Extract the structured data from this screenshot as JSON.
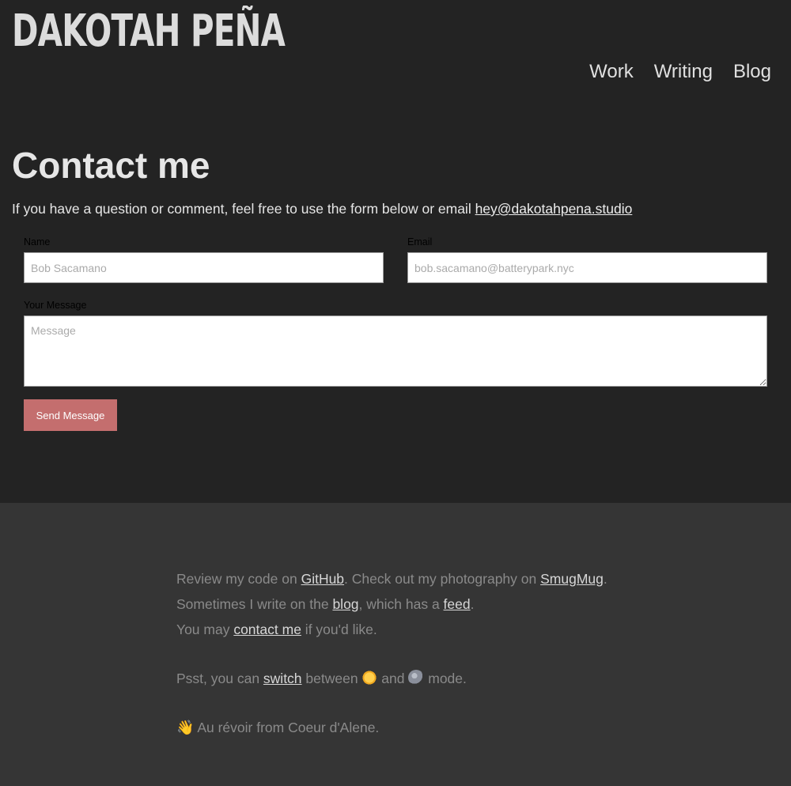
{
  "header": {
    "logo": "DAKOTAH PEÑA",
    "nav": [
      "Work",
      "Writing",
      "Blog"
    ]
  },
  "contact": {
    "title": "Contact me",
    "intro_text": "If you have a question or comment, feel free to use the form below or email ",
    "email_link": "hey@dakotahpena.studio",
    "name_label": "Name",
    "name_placeholder": "Bob Sacamano",
    "email_label": "Email",
    "email_placeholder": "bob.sacamano@batterypark.nyc",
    "message_label": "Your Message",
    "message_placeholder": "Message",
    "send_label": "Send Message"
  },
  "footer": {
    "line1": {
      "t1": "Review my code on ",
      "github": "GitHub",
      "t2": ". Check out my photography on ",
      "smugmug": "SmugMug",
      "t3": "."
    },
    "line2": {
      "t1": "Sometimes I write on the ",
      "blog": "blog",
      "t2": ", which has a ",
      "feed": "feed",
      "t3": "."
    },
    "line3": {
      "t1": "You may ",
      "contact": "contact me",
      "t2": " if you'd like."
    },
    "line4": {
      "t1": "Psst, you can ",
      "switch": "switch",
      "t2": " between ",
      "t3": " and ",
      "t4": " mode."
    },
    "line5": {
      "wave": "👋",
      "t1": " Au révoir from Coeur d'Alene."
    },
    "icons": {
      "sun": "sun-icon",
      "moon": "moon-icon",
      "wave": "waving-hand-icon"
    }
  },
  "colors": {
    "background": "#232323",
    "footer_background": "#353535",
    "button": "#c46e6e"
  }
}
